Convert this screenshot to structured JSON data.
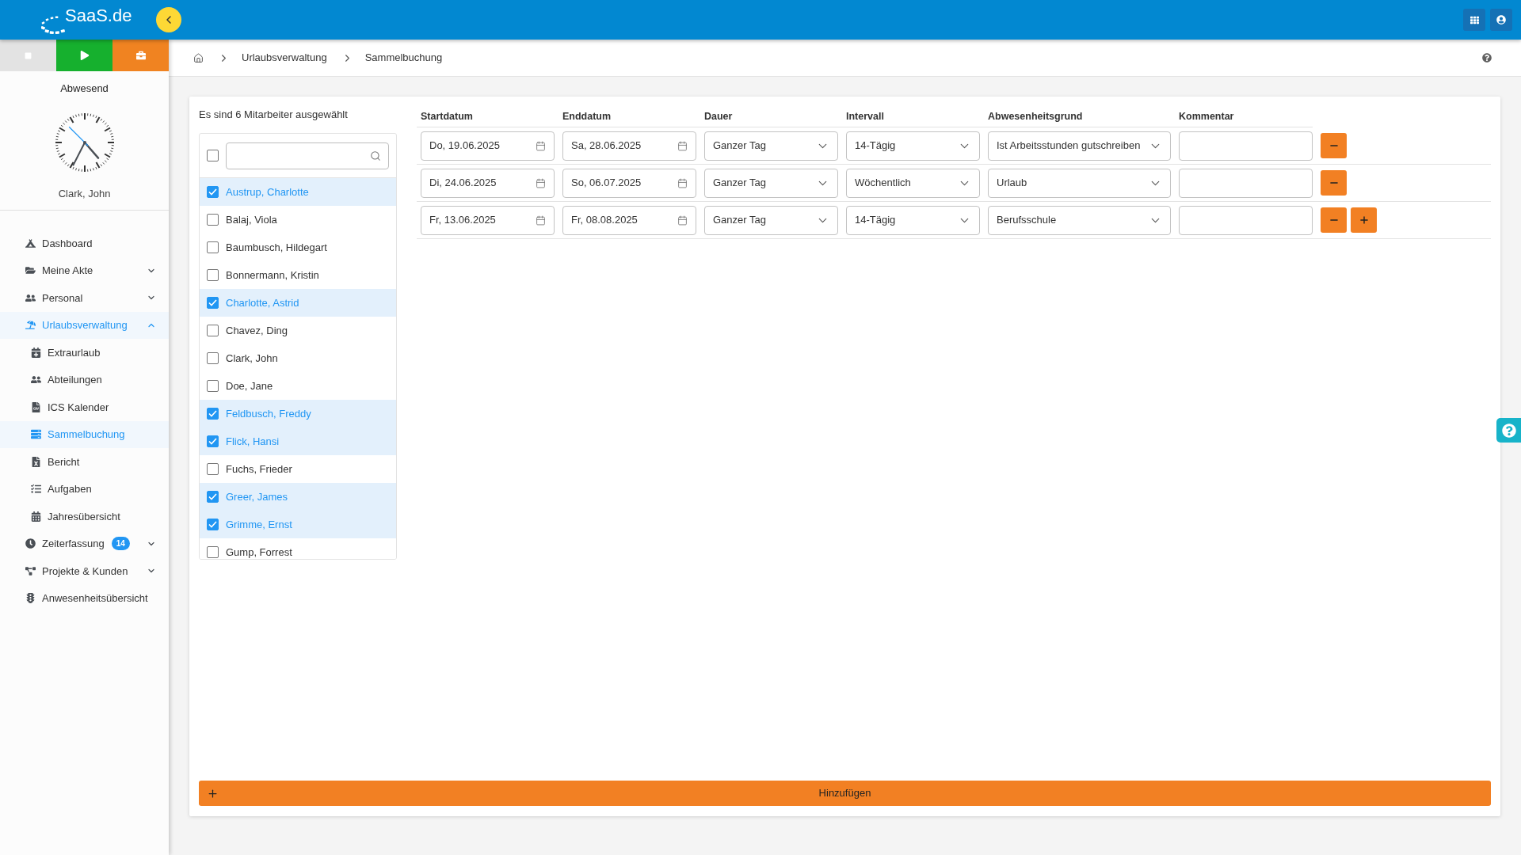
{
  "header": {
    "logo": "SaaS.de"
  },
  "status_buttons": [
    {
      "kind": "stop",
      "color": "#e3e3e3"
    },
    {
      "kind": "start",
      "color": "#16b02e"
    },
    {
      "kind": "break",
      "color": "#f08321"
    }
  ],
  "profile": {
    "status": "Abwesend",
    "name": "Clark, John"
  },
  "nav": [
    {
      "label": "Dashboard",
      "selected": false
    },
    {
      "label": "Meine Akte",
      "selected": false,
      "expanded": false
    },
    {
      "label": "Personal",
      "selected": false,
      "expanded": false
    },
    {
      "label": "Urlaubsverwaltung",
      "selected": true,
      "expanded": true,
      "children": [
        {
          "label": "Extraurlaub",
          "selected": false
        },
        {
          "label": "Abteilungen",
          "selected": false
        },
        {
          "label": "ICS Kalender",
          "selected": false
        },
        {
          "label": "Sammelbuchung",
          "selected": true
        },
        {
          "label": "Bericht",
          "selected": false
        },
        {
          "label": "Aufgaben",
          "selected": false
        },
        {
          "label": "Jahresübersicht",
          "selected": false
        }
      ]
    },
    {
      "label": "Zeiterfassung",
      "selected": false,
      "expanded": false,
      "badge": "14"
    },
    {
      "label": "Projekte & Kunden",
      "selected": false,
      "expanded": false
    },
    {
      "label": "Anwesenheitsübersicht",
      "selected": false
    }
  ],
  "breadcrumb": [
    "Urlaubsverwaltung",
    "Sammelbuchung"
  ],
  "employees": {
    "summary": "Es sind 6 Mitarbeiter ausgewählt",
    "select_all": {
      "checked": false
    },
    "items": [
      {
        "name": "Austrup, Charlotte",
        "checked": true
      },
      {
        "name": "Balaj, Viola",
        "checked": false
      },
      {
        "name": "Baumbusch, Hildegart",
        "checked": false
      },
      {
        "name": "Bonnermann, Kristin",
        "checked": false
      },
      {
        "name": "Charlotte, Astrid",
        "checked": true
      },
      {
        "name": "Chavez, Ding",
        "checked": false
      },
      {
        "name": "Clark, John",
        "checked": false
      },
      {
        "name": "Doe, Jane",
        "checked": false
      },
      {
        "name": "Feldbusch, Freddy",
        "checked": true
      },
      {
        "name": "Flick, Hansi",
        "checked": true
      },
      {
        "name": "Fuchs, Frieder",
        "checked": false
      },
      {
        "name": "Greer, James",
        "checked": true
      },
      {
        "name": "Grimme, Ernst",
        "checked": true
      },
      {
        "name": "Gump, Forrest",
        "checked": false
      }
    ]
  },
  "booking_form": {
    "columns": [
      "Startdatum",
      "Enddatum",
      "Dauer",
      "Intervall",
      "Abwesenheitsgrund",
      "Kommentar"
    ],
    "rows": [
      {
        "start_date": "Do, 19.06.2025",
        "end_date": "Sa, 28.06.2025",
        "duration": "Ganzer Tag",
        "interval": "14-Tägig",
        "reason": "Ist Arbeitsstunden gutschreiben",
        "actions": [
          {
            "kind": "remove"
          }
        ]
      },
      {
        "start_date": "Di, 24.06.2025",
        "end_date": "So, 06.07.2025",
        "duration": "Ganzer Tag",
        "interval": "Wöchentlich",
        "reason": "Urlaub",
        "actions": [
          {
            "kind": "remove"
          }
        ]
      },
      {
        "start_date": "Fr, 13.06.2025",
        "end_date": "Fr, 08.08.2025",
        "duration": "Ganzer Tag",
        "interval": "14-Tägig",
        "reason": "Berufsschule",
        "actions": [
          {
            "kind": "remove"
          },
          {
            "kind": "add"
          }
        ]
      }
    ]
  },
  "add_button": {
    "label": "Hinzufügen"
  }
}
